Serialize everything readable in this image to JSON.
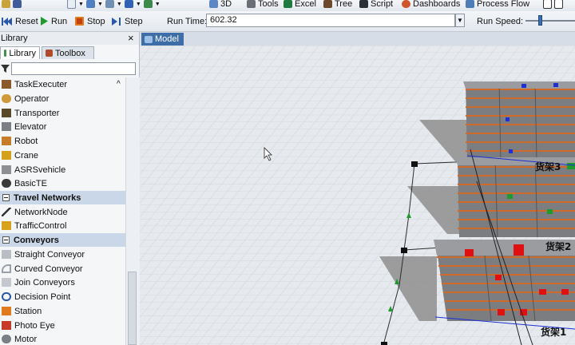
{
  "toolbar_top": {
    "btn_3d": "3D",
    "btn_tools": "Tools",
    "btn_excel": "Excel",
    "btn_tree": "Tree",
    "btn_script": "Script",
    "btn_dashboards": "Dashboards",
    "btn_process_flow": "Process Flow"
  },
  "run_controls": {
    "reset": "Reset",
    "run": "Run",
    "stop": "Stop",
    "step": "Step",
    "run_time_label": "Run Time:",
    "run_time_value": "602.32",
    "run_speed_label": "Run Speed:",
    "run_speed_level": 0.28
  },
  "library": {
    "title": "Library",
    "close": "×",
    "tabs": [
      {
        "label": "Library"
      },
      {
        "label": "Toolbox"
      }
    ],
    "filter_placeholder": "",
    "items": [
      {
        "label": "TaskExecuter"
      },
      {
        "label": "Operator"
      },
      {
        "label": "Transporter"
      },
      {
        "label": "Elevator"
      },
      {
        "label": "Robot"
      },
      {
        "label": "Crane"
      },
      {
        "label": "ASRSvehicle"
      },
      {
        "label": "BasicTE"
      }
    ],
    "travel_networks": {
      "label": "Travel Networks",
      "items": [
        {
          "label": "NetworkNode"
        },
        {
          "label": "TrafficControl"
        }
      ]
    },
    "conveyors": {
      "label": "Conveyors",
      "items": [
        {
          "label": "Straight Conveyor"
        },
        {
          "label": "Curved Conveyor"
        },
        {
          "label": "Join Conveyors"
        },
        {
          "label": "Decision Point"
        },
        {
          "label": "Station"
        },
        {
          "label": "Photo Eye"
        },
        {
          "label": "Motor"
        }
      ]
    }
  },
  "model": {
    "tab_label": "Model",
    "rack_labels": [
      "货架3",
      "货架2",
      "货架1"
    ]
  },
  "colors": {
    "accent": "#3d6ea8",
    "category_bg": "#c9d7e8",
    "rack_orange": "#d9672a",
    "box_red": "#e01010",
    "box_green": "#1f9a2e",
    "box_blue": "#1c2fd6"
  }
}
